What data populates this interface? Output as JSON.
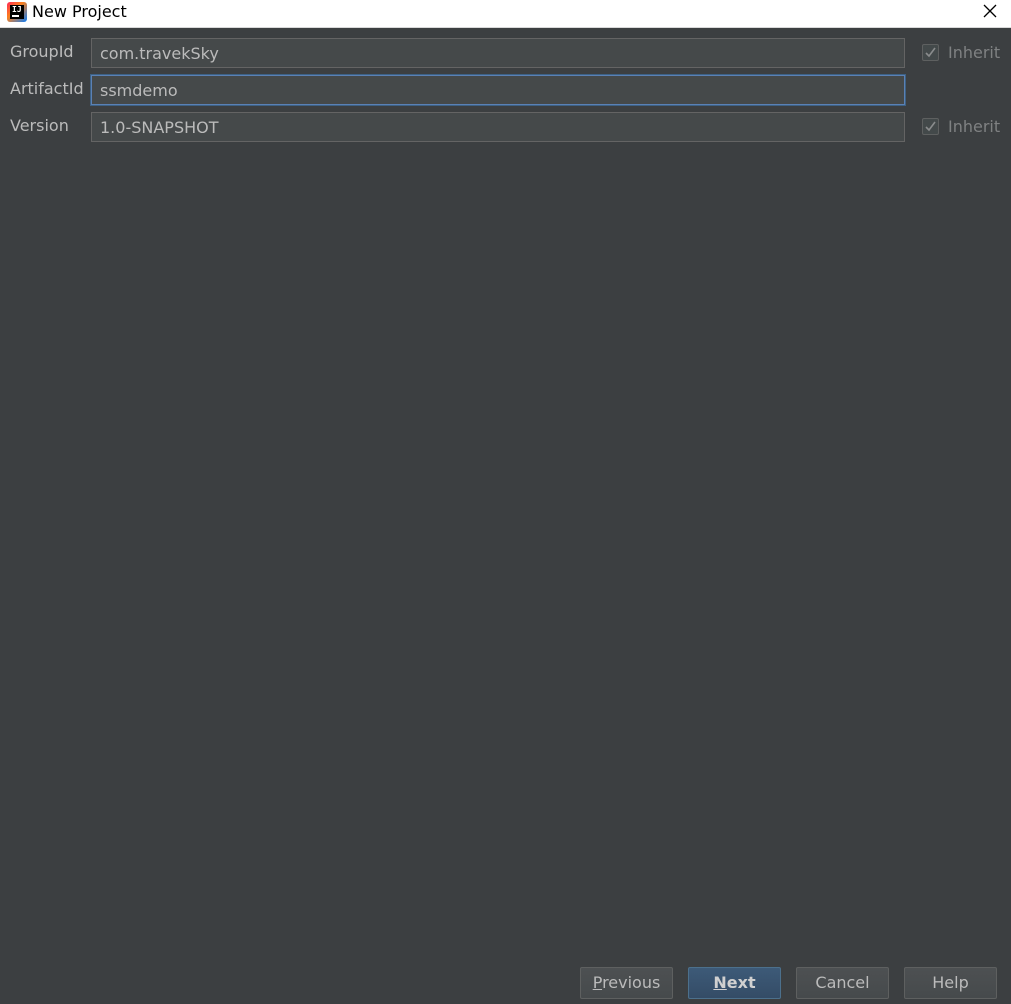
{
  "window": {
    "title": "New Project",
    "app_icon": "intellij-idea-icon",
    "close_icon": "close-icon"
  },
  "form": {
    "group_id": {
      "label": "GroupId",
      "value": "com.travekSky",
      "inherit_label": "Inherit",
      "inherit_checked": true
    },
    "artifact_id": {
      "label": "ArtifactId",
      "value": "ssmdemo",
      "focused": true
    },
    "version": {
      "label": "Version",
      "value": "1.0-SNAPSHOT",
      "inherit_label": "Inherit",
      "inherit_checked": true
    }
  },
  "buttons": {
    "previous": {
      "mnemonic": "P",
      "rest": "revious"
    },
    "next": {
      "mnemonic": "N",
      "rest": "ext"
    },
    "cancel": "Cancel",
    "help": "Help"
  },
  "colors": {
    "background": "#3c3f41",
    "field_background": "#45494a",
    "focus_border": "#5a81b5",
    "primary_button": "#365880"
  }
}
